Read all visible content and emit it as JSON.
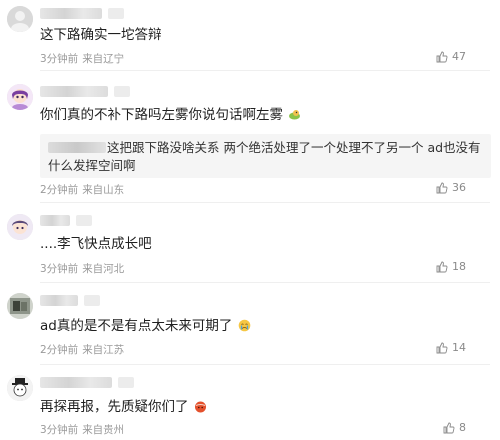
{
  "comments": [
    {
      "text": "这下路确实一坨答辩",
      "time": "3分钟前",
      "location": "来自辽宁",
      "likes": "47"
    },
    {
      "text": "你们真的不补下路吗左雾你说句话啊左雾",
      "reply": "这把跟下路没啥关系 两个绝活处理了一个处理不了另一个 ad也没有什么发挥空间啊",
      "time": "2分钟前",
      "location": "来自山东",
      "likes": "36"
    },
    {
      "text": "....李飞快点成长吧",
      "time": "3分钟前",
      "location": "来自河北",
      "likes": "18"
    },
    {
      "text": "ad真的是不是有点太未来可期了",
      "time": "2分钟前",
      "location": "来自江苏",
      "likes": "14"
    },
    {
      "text": "再探再报，先质疑你们了",
      "time": "3分钟前",
      "location": "来自贵州",
      "likes": "8"
    }
  ]
}
